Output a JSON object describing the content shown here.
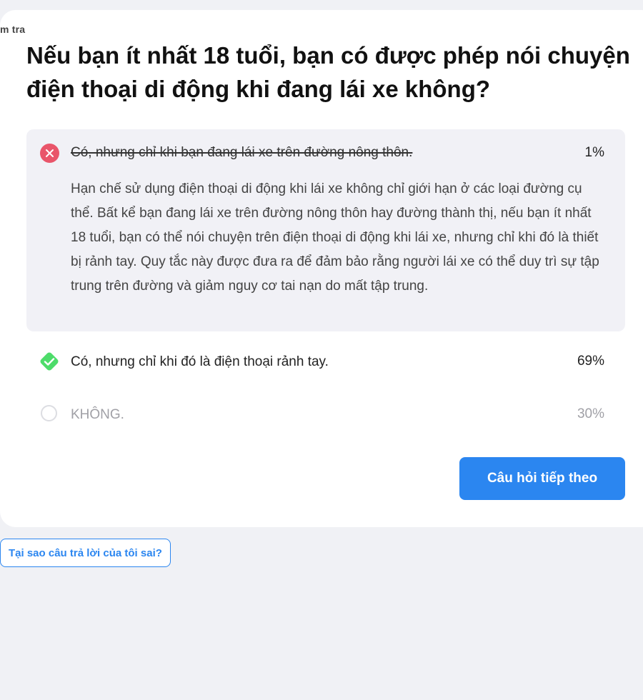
{
  "header": {
    "crumb": "m tra"
  },
  "question": {
    "text": "Nếu bạn ít nhất 18 tuổi, bạn có được phép nói chuyện điện thoại di động khi đang lái xe không?"
  },
  "answers": [
    {
      "text": "Có, nhưng chỉ khi bạn đang lái xe trên đường nông thôn.",
      "percent": "1%",
      "state": "wrong-selected",
      "explanation": "Hạn chế sử dụng điện thoại di động khi lái xe không chỉ giới hạn ở các loại đường cụ thể. Bất kể bạn đang lái xe trên đường nông thôn hay đường thành thị, nếu bạn ít nhất 18 tuổi, bạn có thể nói chuyện trên điện thoại di động khi lái xe, nhưng chỉ khi đó là thiết bị rảnh tay. Quy tắc này được đưa ra để đảm bảo rằng người lái xe có thể duy trì sự tập trung trên đường và giảm nguy cơ tai nạn do mất tập trung.",
      "icon": "x-circle-icon"
    },
    {
      "text": "Có, nhưng chỉ khi đó là điện thoại rảnh tay.",
      "percent": "69%",
      "state": "correct",
      "icon": "check-diamond-icon"
    },
    {
      "text": "KHÔNG.",
      "percent": "30%",
      "state": "unselected",
      "icon": "empty-circle-icon"
    }
  ],
  "actions": {
    "next_label": "Câu hỏi tiếp theo",
    "why_label": "Tại sao câu trả lời của tôi sai?"
  },
  "colors": {
    "accent": "#2b86f0",
    "wrong": "#e9556a",
    "correct": "#4ddc6a",
    "background": "#f0f1f5"
  }
}
